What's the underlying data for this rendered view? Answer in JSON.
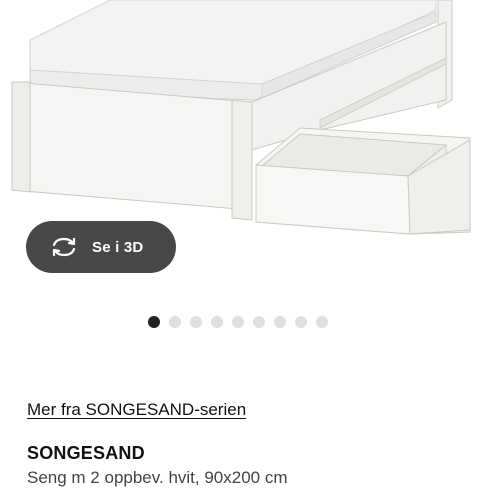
{
  "product_image": {
    "alt": "SONGESAND seng med 2 oppbevaringsbokser, hvit"
  },
  "view3d_button": {
    "label": "Se i 3D",
    "icon": "rotate-3d-icon"
  },
  "carousel": {
    "total": 9,
    "active_index": 0
  },
  "series_link": {
    "label": "Mer fra SONGESAND-serien"
  },
  "product": {
    "name": "SONGESAND",
    "description": "Seng m 2 oppbev. hvit, 90x200 cm"
  },
  "colors": {
    "button_bg": "#484848",
    "dot_active": "#222222",
    "dot_inactive": "#dfdfdf"
  }
}
